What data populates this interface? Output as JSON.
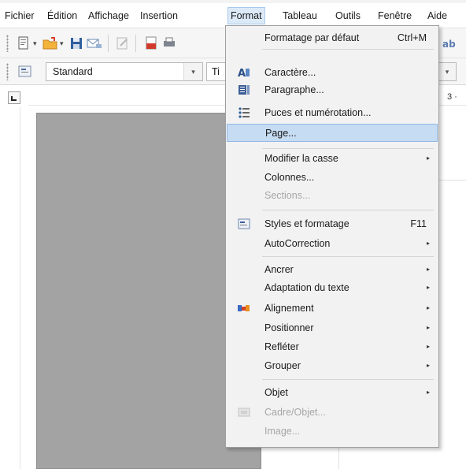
{
  "menubar": {
    "items": [
      {
        "label": "Fichier"
      },
      {
        "label": "Édition"
      },
      {
        "label": "Affichage"
      },
      {
        "label": "Insertion"
      },
      {
        "label": "Format"
      },
      {
        "label": "Tableau"
      },
      {
        "label": "Outils"
      },
      {
        "label": "Fenêtre"
      },
      {
        "label": "Aide"
      }
    ],
    "active": "Format"
  },
  "toolbar": {
    "paragraph_style": "Standard",
    "font_name_partial": "Ti",
    "ruler_number": "3 ·"
  },
  "format_menu": {
    "items": [
      {
        "label": "Formatage par défaut",
        "shortcut": "Ctrl+M"
      },
      {
        "label": "Caractère...",
        "icon": "character-icon"
      },
      {
        "label": "Paragraphe...",
        "icon": "paragraph-icon"
      },
      {
        "label": "Puces et numérotation...",
        "icon": "bullets-numbering-icon"
      },
      {
        "label": "Page...",
        "highlighted": true
      },
      {
        "label": "Modifier la casse",
        "submenu": true
      },
      {
        "label": "Colonnes..."
      },
      {
        "label": "Sections...",
        "disabled": true
      },
      {
        "label": "Styles et formatage",
        "shortcut": "F11",
        "icon": "styles-formatting-icon"
      },
      {
        "label": "AutoCorrection",
        "submenu": true
      },
      {
        "label": "Ancrer",
        "submenu": true
      },
      {
        "label": "Adaptation du texte",
        "submenu": true
      },
      {
        "label": "Alignement",
        "submenu": true,
        "icon": "alignment-icon"
      },
      {
        "label": "Positionner",
        "submenu": true
      },
      {
        "label": "Refléter",
        "submenu": true
      },
      {
        "label": "Grouper",
        "submenu": true
      },
      {
        "label": "Objet",
        "submenu": true
      },
      {
        "label": "Cadre/Objet...",
        "disabled": true,
        "icon": "frame-object-icon"
      },
      {
        "label": "Image...",
        "disabled": true
      }
    ]
  },
  "colors": {
    "highlight_bg": "#c6dcf3",
    "highlight_border": "#8fb8e4",
    "menu_bg": "#f2f2f2",
    "page_gray": "#a3a3a3",
    "disabled_text": "#a6a6a6"
  }
}
